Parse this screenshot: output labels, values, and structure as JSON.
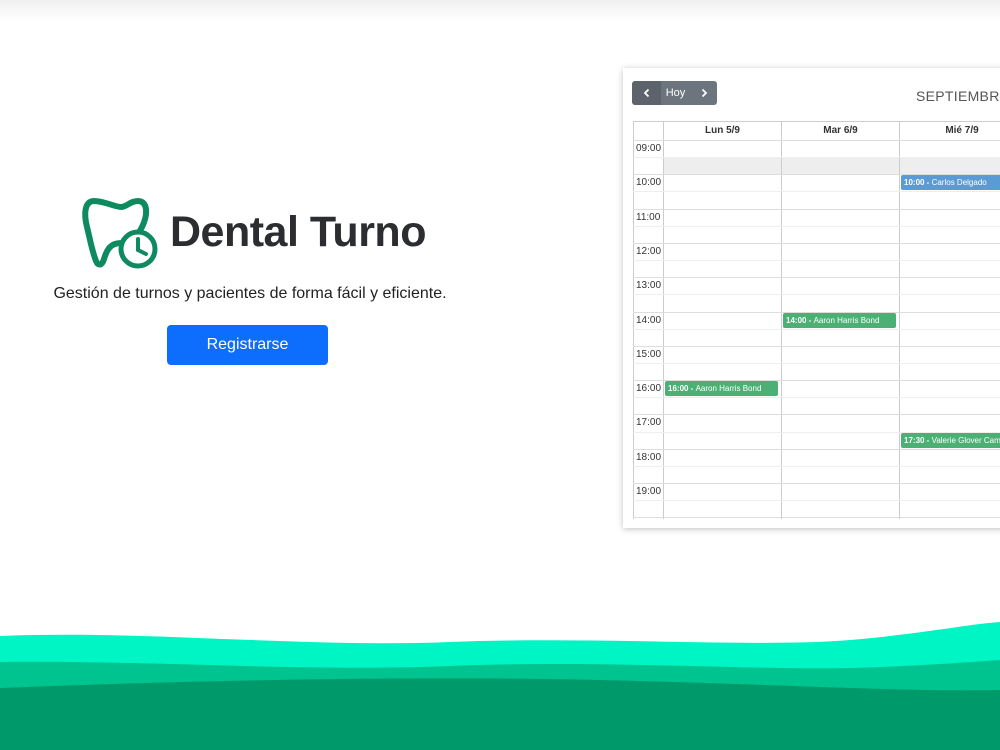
{
  "hero": {
    "app_name": "Dental Turno",
    "tagline": "Gestión de turnos y pacientes de forma fácil y eficiente.",
    "register_label": "Registrarse"
  },
  "calendar": {
    "prev_icon": "chevron-left-icon",
    "today_label": "Hoy",
    "next_icon": "chevron-right-icon",
    "month_title": "SEPTIEMBRE",
    "days": [
      "Lun 5/9",
      "Mar 6/9",
      "Mié 7/9"
    ],
    "hours": [
      "09:00",
      "10:00",
      "11:00",
      "12:00",
      "13:00",
      "14:00",
      "15:00",
      "16:00",
      "17:00",
      "18:00",
      "19:00"
    ],
    "events": [
      {
        "day": 2,
        "time": "10:00",
        "name": "Carlos Delgado",
        "color": "#5b9bd5"
      },
      {
        "day": 1,
        "time": "14:00",
        "name": "Aaron Harris Bond",
        "color": "#4caf74"
      },
      {
        "day": 0,
        "time": "16:00",
        "name": "Aaron Harris Bond",
        "color": "#4caf74"
      },
      {
        "day": 2,
        "time": "17:30",
        "name": "Valerie Glover Cam",
        "color": "#4caf74"
      }
    ]
  },
  "colors": {
    "brand_green": "#0e8a5f",
    "primary_button": "#0d6efd",
    "wave_light": "#00f5c4",
    "wave_mid": "#00c48f",
    "wave_dark": "#009a6a"
  }
}
